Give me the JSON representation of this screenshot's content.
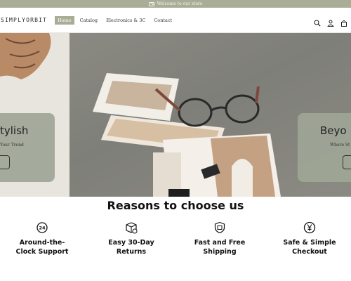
{
  "announcement": {
    "text": "Welcome to our store",
    "icon": "mail-icon"
  },
  "header": {
    "logo": "SIMPLYORBIT",
    "nav": [
      {
        "label": "Home",
        "active": true
      },
      {
        "label": "Catalog",
        "active": false
      },
      {
        "label": "Electronics & 3C",
        "active": false
      },
      {
        "label": "Contact",
        "active": false
      }
    ],
    "icons": [
      "search-icon",
      "account-icon",
      "cart-icon"
    ]
  },
  "hero": {
    "left": {
      "heading": "tylish",
      "subtext": "Your Trend"
    },
    "right": {
      "heading": "Beyo",
      "subtext": "Where St"
    }
  },
  "reasons": {
    "title": "Reasons to choose us",
    "items": [
      {
        "line1": "Around-the-",
        "line2": "Clock Support",
        "icon": "support-24-icon"
      },
      {
        "line1": "Easy 30-Day",
        "line2": "Returns",
        "icon": "return-box-icon"
      },
      {
        "line1": "Fast and Free",
        "line2": "Shipping",
        "icon": "shipping-shield-icon"
      },
      {
        "line1": "Safe & Simple",
        "line2": "Checkout",
        "icon": "yen-coin-icon"
      }
    ]
  },
  "colors": {
    "accent": "#a9ad96",
    "card": "#9ea696",
    "text": "#111111"
  }
}
